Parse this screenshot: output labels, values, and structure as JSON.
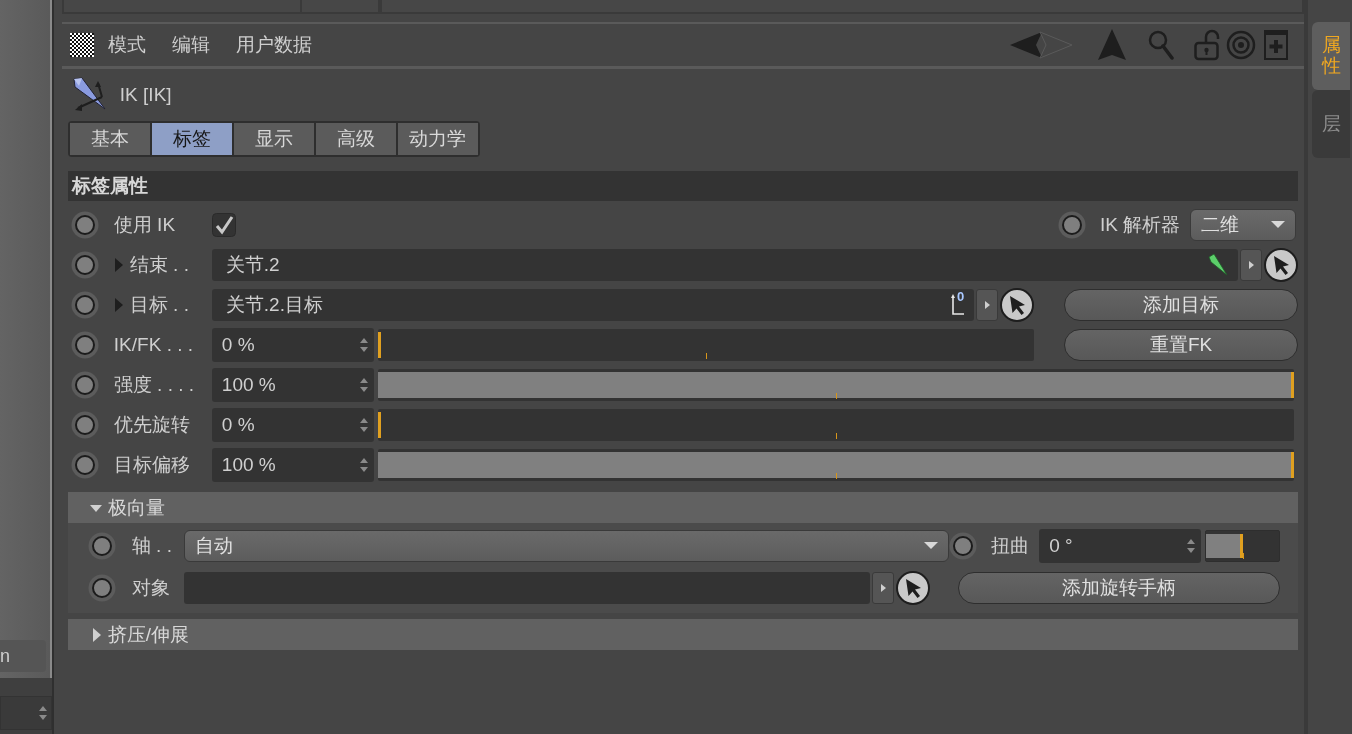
{
  "left_panel": {
    "label": "n"
  },
  "menu": [
    {
      "label": "模式"
    },
    {
      "label": "编辑"
    },
    {
      "label": "用户数据"
    }
  ],
  "object": {
    "title": "IK [IK]"
  },
  "tabs": [
    {
      "label": "基本",
      "selected": false
    },
    {
      "label": "标签",
      "selected": true
    },
    {
      "label": "显示",
      "selected": false
    },
    {
      "label": "高级",
      "selected": false
    },
    {
      "label": "动力学",
      "selected": false
    }
  ],
  "section": {
    "title": "标签属性"
  },
  "params": [
    {
      "kind": "checkbox",
      "label": "使用 IK",
      "checked": true,
      "extra": {
        "label": "IK 解析器",
        "value": "二维"
      }
    },
    {
      "kind": "link",
      "label": "结束 . .",
      "value": "关节.2",
      "expanded": false,
      "field_icon": {
        "kind": "joint"
      }
    },
    {
      "kind": "link",
      "label": "目标 . .",
      "value": "关节.2.目标",
      "expanded": false,
      "field_icon": {
        "kind": "axis",
        "badge": "0"
      },
      "button": "添加目标"
    },
    {
      "kind": "slider",
      "label": "IK/FK . . .",
      "value": "0 %",
      "level": 0,
      "button": "重置FK"
    },
    {
      "kind": "slider",
      "label": "强度 . . . .",
      "value": "100 %",
      "level": 1
    },
    {
      "kind": "slider",
      "label": "优先旋转",
      "value": "0 %",
      "level": 0
    },
    {
      "kind": "slider",
      "label": "目标偏移",
      "value": "100 %",
      "level": 1
    }
  ],
  "pole_vector": {
    "title": "极向量",
    "expanded": true,
    "axis": {
      "label": "轴 . .",
      "value": "自动"
    },
    "twist": {
      "label": "扭曲",
      "value": "0 °",
      "level": 0.5
    },
    "object": {
      "label": "对象",
      "button": "添加旋转手柄"
    }
  },
  "squash": {
    "title": "挤压/伸展",
    "expanded": false
  },
  "side_tabs": [
    {
      "label": "属性",
      "selected": true
    },
    {
      "label": "层",
      "selected": false
    }
  ]
}
